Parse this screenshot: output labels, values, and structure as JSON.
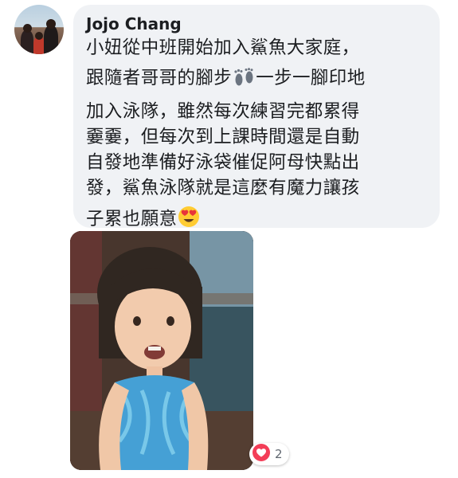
{
  "comment": {
    "author": "Jojo Chang",
    "lines": [
      "小妞從中班開始加入鯊魚大家庭，",
      "跟隨者哥哥的腳步",
      "一步一腳印地",
      "加入泳隊，雖然每次練習完都累得",
      "嫑嫑，但每次到上課時間還是自動",
      "自發地準備好泳袋催促阿母快點出",
      "發，鯊魚泳隊就是這麼有魔力讓孩",
      "子累也願意"
    ],
    "icons": {
      "footprints": "footprints-icon",
      "emoji": "heart-eyes-emoji-icon",
      "reaction": "love-reaction-icon"
    }
  },
  "reactions": {
    "count": "2",
    "color": "#f33e58"
  },
  "colors": {
    "bubble": "#f0f2f5",
    "text": "#1c1e21",
    "meta": "#606770"
  }
}
